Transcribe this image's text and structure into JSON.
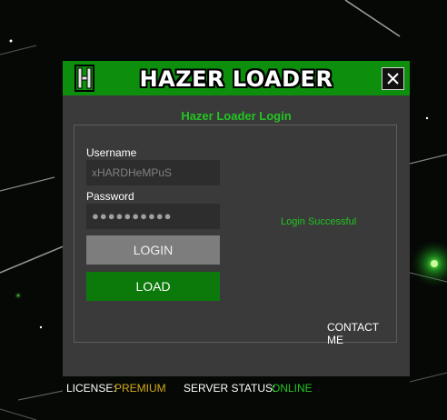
{
  "window": {
    "title": "HAZER LOADER",
    "logo_letter": "H",
    "close_icon": "close-icon"
  },
  "login": {
    "heading": "Hazer Loader Login",
    "username_label": "Username",
    "username_value": "xHARDHeMPuS",
    "password_label": "Password",
    "password_value": "●●●●●●●●●●",
    "login_button": "LOGIN",
    "load_button": "LOAD",
    "status_message": "Login Successful",
    "contact_link": "CONTACT ME"
  },
  "footer": {
    "license_label": "LICENSE:",
    "license_value": "PREMIUM",
    "server_label": "SERVER STATUS:",
    "server_value": "ONLINE"
  },
  "colors": {
    "accent_green": "#0d8f0d",
    "status_green": "#22c422",
    "premium": "#d4a91c",
    "online": "#22c422"
  }
}
